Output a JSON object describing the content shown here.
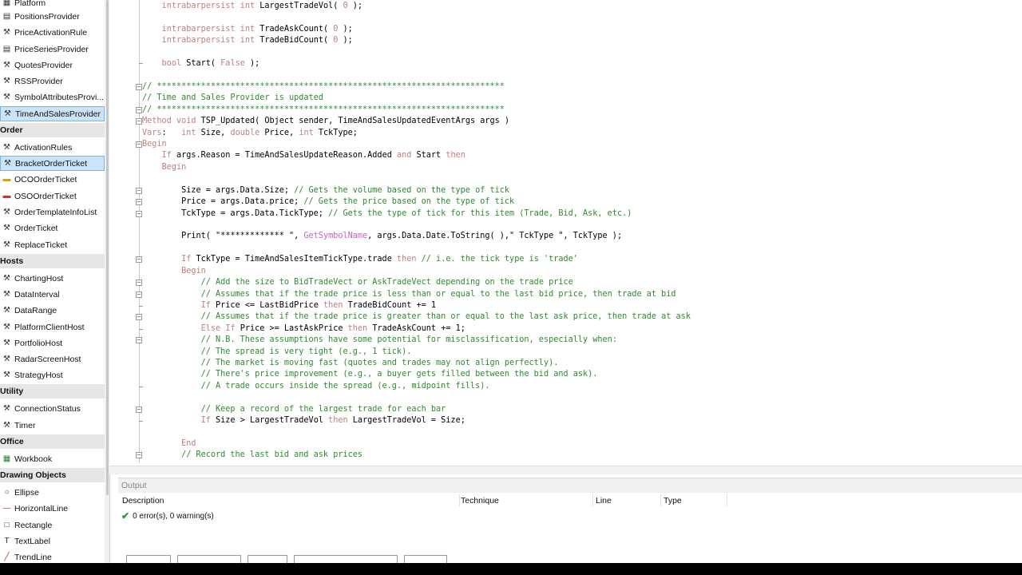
{
  "toolbox": {
    "rows": [
      {
        "type": "item",
        "label": "Platform",
        "icon": "platform-icon"
      },
      {
        "type": "item",
        "label": "PositionsProvider",
        "icon": "positions-provider-icon"
      },
      {
        "type": "item",
        "label": "PriceActivationRule",
        "icon": "price-activation-rule-icon"
      },
      {
        "type": "item",
        "label": "PriceSeriesProvider",
        "icon": "price-series-provider-icon"
      },
      {
        "type": "item",
        "label": "QuotesProvider",
        "icon": "quotes-provider-icon"
      },
      {
        "type": "item",
        "label": "RSSProvider",
        "icon": "rss-provider-icon"
      },
      {
        "type": "item",
        "label": "SymbolAttributesProvi...",
        "icon": "symbol-attributes-provider-icon"
      },
      {
        "type": "item",
        "label": "TimeAndSalesProvider",
        "icon": "time-and-sales-provider-icon",
        "selected": true
      },
      {
        "type": "cat",
        "label": "Order"
      },
      {
        "type": "item",
        "label": "ActivationRules",
        "icon": "activation-rules-icon"
      },
      {
        "type": "item",
        "label": "BracketOrderTicket",
        "icon": "bracket-order-ticket-icon",
        "selected": true
      },
      {
        "type": "item",
        "label": "OCOOrderTicket",
        "icon": "oco-order-ticket-icon"
      },
      {
        "type": "item",
        "label": "OSOOrderTicket",
        "icon": "oso-order-ticket-icon"
      },
      {
        "type": "item",
        "label": "OrderTemplateInfoList",
        "icon": "order-template-info-list-icon"
      },
      {
        "type": "item",
        "label": "OrderTicket",
        "icon": "order-ticket-icon"
      },
      {
        "type": "item",
        "label": "ReplaceTicket",
        "icon": "replace-ticket-icon"
      },
      {
        "type": "cat",
        "label": "Hosts"
      },
      {
        "type": "item",
        "label": "ChartingHost",
        "icon": "charting-host-icon"
      },
      {
        "type": "item",
        "label": "DataInterval",
        "icon": "data-interval-icon"
      },
      {
        "type": "item",
        "label": "DataRange",
        "icon": "data-range-icon"
      },
      {
        "type": "item",
        "label": "PlatformClientHost",
        "icon": "platform-client-host-icon"
      },
      {
        "type": "item",
        "label": "PortfolioHost",
        "icon": "portfolio-host-icon"
      },
      {
        "type": "item",
        "label": "RadarScreenHost",
        "icon": "radar-screen-host-icon"
      },
      {
        "type": "item",
        "label": "StrategyHost",
        "icon": "strategy-host-icon"
      },
      {
        "type": "cat",
        "label": "Utility"
      },
      {
        "type": "item",
        "label": "ConnectionStatus",
        "icon": "connection-status-icon"
      },
      {
        "type": "item",
        "label": "Timer",
        "icon": "timer-icon"
      },
      {
        "type": "cat",
        "label": "Office"
      },
      {
        "type": "item",
        "label": "Workbook",
        "icon": "workbook-icon"
      },
      {
        "type": "cat",
        "label": "Drawing Objects"
      },
      {
        "type": "item",
        "label": "Ellipse",
        "icon": "ellipse-icon"
      },
      {
        "type": "item",
        "label": "HorizontalLine",
        "icon": "horizontal-line-icon"
      },
      {
        "type": "item",
        "label": "Rectangle",
        "icon": "rectangle-icon"
      },
      {
        "type": "item",
        "label": "TextLabel",
        "icon": "text-label-icon"
      },
      {
        "type": "item",
        "label": "TrendLine",
        "icon": "trend-line-icon"
      }
    ]
  },
  "editor": {
    "lines": [
      {
        "t": "    intrabarpersist int LargestTradeVol( 0 );"
      },
      {
        "t": ""
      },
      {
        "t": "    intrabarpersist int TradeAskCount( 0 );"
      },
      {
        "t": "    intrabarpersist int TradeBidCount( 0 );"
      },
      {
        "t": ""
      },
      {
        "t": "    bool Start( False );"
      },
      {
        "t": ""
      },
      {
        "t": "// ***********************************************************************",
        "c": "cm",
        "fold": "box"
      },
      {
        "t": "// Time and Sales Provider is updated",
        "c": "cm"
      },
      {
        "t": "// ***********************************************************************",
        "c": "cm",
        "fold": "box"
      },
      {
        "t": "Method void TSP_Updated( Object sender, TimeAndSalesUpdatedEventArgs args )",
        "fold": "box"
      },
      {
        "t": "Vars:   int Size, double Price, int TckType;"
      },
      {
        "t": "Begin",
        "fold": "box"
      },
      {
        "t": "    If args.Reason = TimeAndSalesUpdateReason.Added and Start then"
      },
      {
        "t": "    Begin"
      },
      {
        "t": ""
      },
      {
        "t": "        Size = args.Data.Size; // Gets the volume based on the type of tick",
        "fold": "box"
      },
      {
        "t": "        Price = args.Data.price; // Gets the price based on the type of tick",
        "fold": "box"
      },
      {
        "t": "        TckType = args.Data.TickType; // Gets the type of tick for this item (Trade, Bid, Ask, etc.)",
        "fold": "box"
      },
      {
        "t": ""
      },
      {
        "t": "        Print( \"************* \", GetSymbolName, args.Data.Date.ToString( ),\" TckType \", TckType );"
      },
      {
        "t": ""
      },
      {
        "t": "        If TckType = TimeAndSalesItemTickType.trade then // i.e. the tick type is 'trade'",
        "fold": "box"
      },
      {
        "t": "        Begin"
      },
      {
        "t": "            // Add the size to BidTradeVect or AskTradeVect depending on the trade price",
        "fold": "box"
      },
      {
        "t": "            // Assumes that if the trade price is less than or equal to the last bid price, then trade at bid",
        "fold": "box"
      },
      {
        "t": "            If Price <= LastBidPrice then TradeBidCount += 1",
        "fold": "end"
      },
      {
        "t": "            // Assumes that if the trade price is greater than or equal to the last ask price, then trade at ask",
        "fold": "box"
      },
      {
        "t": "            Else If Price >= LastAskPrice then TradeAskCount += 1;",
        "fold": "end"
      },
      {
        "t": "            // N.B. These assumptions have some potential for misclassification, especially when:",
        "fold": "box"
      },
      {
        "t": "            // The spread is very tight (e.g., 1 tick).",
        "c": "cm"
      },
      {
        "t": "            // The market is moving fast (quotes and trades may not align perfectly).",
        "c": "cm"
      },
      {
        "t": "            // There's price improvement (e.g., a buyer gets filled between the bid and ask).",
        "c": "cm"
      },
      {
        "t": "            // A trade occurs inside the spread (e.g., midpoint fills).",
        "c": "cm",
        "fold": "end"
      },
      {
        "t": ""
      },
      {
        "t": "            // Keep a record of the largest trade for each bar",
        "fold": "box"
      },
      {
        "t": "            If Size > LargestTradeVol then LargestTradeVol = Size;",
        "fold": "end"
      },
      {
        "t": ""
      },
      {
        "t": "        End"
      },
      {
        "t": "        // Record the last bid and ask prices",
        "c": "cm",
        "fold": "box"
      }
    ]
  },
  "output": {
    "title": "Output",
    "col_description": "Description",
    "col_technique": "Technique",
    "col_line": "Line",
    "col_type": "Type",
    "status": "0 error(s), 0 warning(s)"
  }
}
